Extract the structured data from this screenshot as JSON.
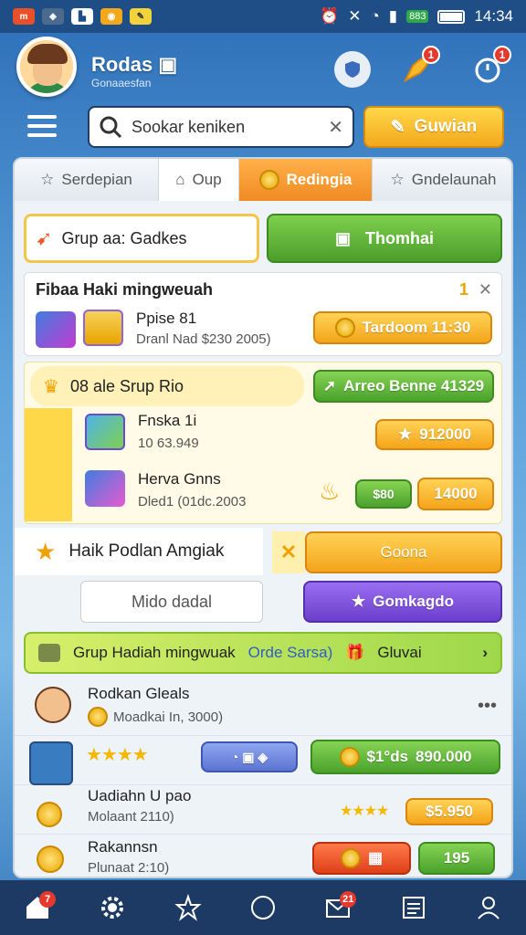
{
  "status": {
    "time": "14:34",
    "battery": "883"
  },
  "header": {
    "title": "Rodas",
    "subtitle": "Gonaaesfan",
    "notif_count": "1"
  },
  "search": {
    "placeholder": "Sookar keniken",
    "go_label": "Guwian"
  },
  "tabs": [
    "Serdepian",
    "Oup",
    "Redingia",
    "Gndelaunah"
  ],
  "group": {
    "label": "Grup aa: Gadkes",
    "action": "Thomhai"
  },
  "weekly": {
    "title": "Fibaa Haki mingweuah",
    "count": "1",
    "item_name": "Ppise 81",
    "item_sub": "Dranl Nad $230 2005)",
    "button": "Tardoom 11:30"
  },
  "sale": {
    "head": "08 ale Srup Rio",
    "green_btn": "Arreo Benne 41329",
    "item1_name": "Fnska 1i",
    "item1_sub": "10 63.949",
    "item1_btn": "912000",
    "item2_name": "Herva Gnns",
    "item2_sub": "Dled1 (01dc.2003",
    "item2_btn": "14000",
    "item2_tag": "$80"
  },
  "daily": {
    "title": "Haik Podlan Amgiak",
    "yellow_btn": "Goona",
    "input": "Mido dadal",
    "purple_btn": "Gomkagdo"
  },
  "list_header": {
    "label": "Grup Hadiah mingwuak",
    "blue": "Orde Sarsa)",
    "right": "Gluvai"
  },
  "list": [
    {
      "name": "Rodkan Gleals",
      "sub": "Moadkai In, 3000)"
    },
    {
      "name": "",
      "sub": "",
      "btn": "$1°ds",
      "value": "890.000"
    },
    {
      "name": "Uadiahn U pao",
      "sub": "Molaant 2110)",
      "btn": "$5.950"
    },
    {
      "name": "Rakannsn",
      "sub": "Plunaat 2:10)",
      "btn": "195"
    }
  ],
  "nav_badge_home": "7",
  "nav_badge_mail": "21"
}
